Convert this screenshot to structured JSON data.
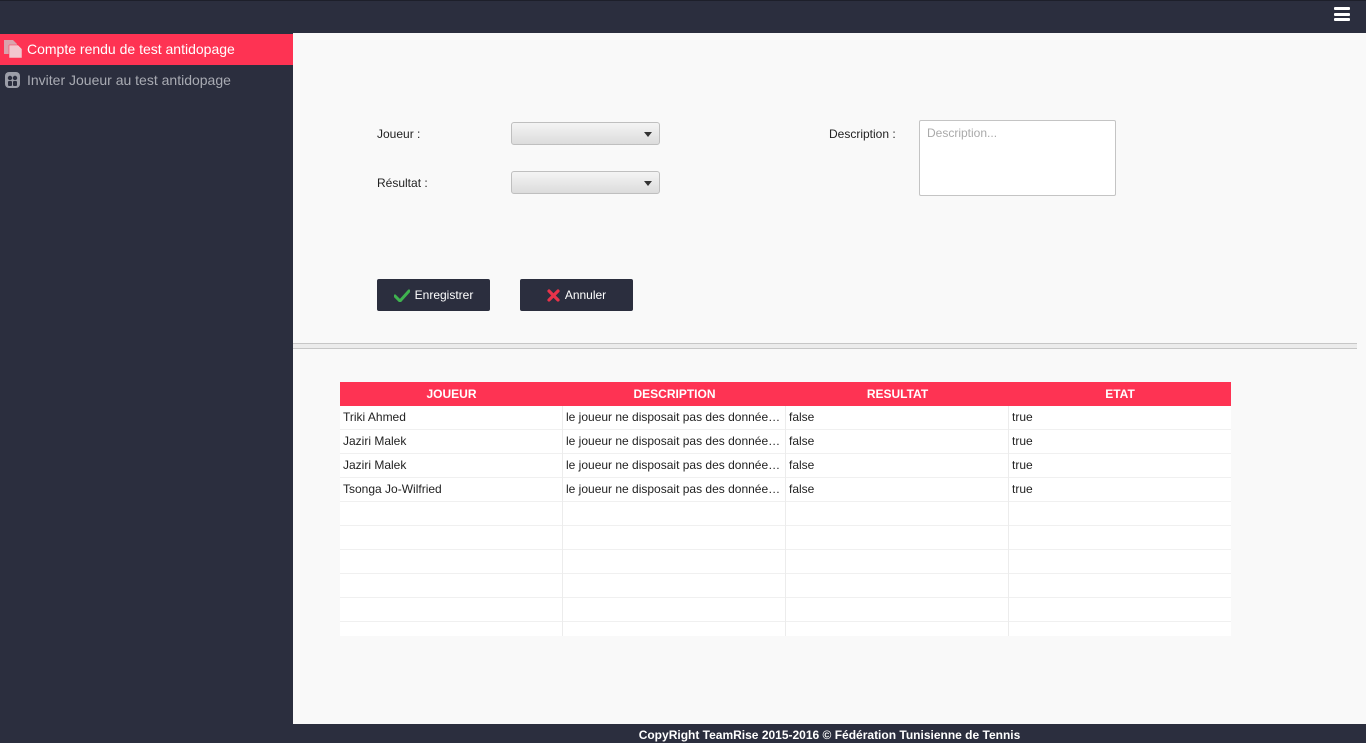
{
  "colors": {
    "accent": "#fe3353",
    "dark": "#2b2e3e",
    "background": "#f9f9f9",
    "ok_green": "#3fb34f",
    "cancel_red": "#e8334a"
  },
  "header": {
    "menu_icon": "hamburger-icon"
  },
  "sidebar": {
    "items": [
      {
        "label": "Compte rendu de test antidopage",
        "icon": "document-icon",
        "active": true
      },
      {
        "label": "Inviter Joueur au test antidopage",
        "icon": "players-icon",
        "active": false
      }
    ]
  },
  "form": {
    "joueur_label": "Joueur :",
    "joueur_value": "",
    "resultat_label": "Résultat :",
    "resultat_value": "",
    "description_label": "Description :",
    "description_placeholder": "Description...",
    "description_value": "",
    "save_label": "Enregistrer",
    "save_icon": "check-icon",
    "cancel_label": "Annuler",
    "cancel_icon": "cross-icon"
  },
  "table": {
    "columns": [
      "JOUEUR",
      "DESCRIPTION",
      "RESULTAT",
      "ETAT"
    ],
    "rows": [
      [
        "Triki Ahmed",
        "le joueur ne disposait pas des données médicales",
        "false",
        "true"
      ],
      [
        "Jaziri Malek",
        "le joueur ne disposait pas des données médicales",
        "false",
        "true"
      ],
      [
        "Jaziri Malek",
        "le joueur ne disposait pas des données médicales",
        "false",
        "true"
      ],
      [
        "Tsonga Jo-Wilfried",
        "le joueur ne disposait pas des données médicales",
        "false",
        "true"
      ]
    ]
  },
  "footer": {
    "text": "CopyRight TeamRise 2015-2016 © Fédération Tunisienne de Tennis"
  }
}
